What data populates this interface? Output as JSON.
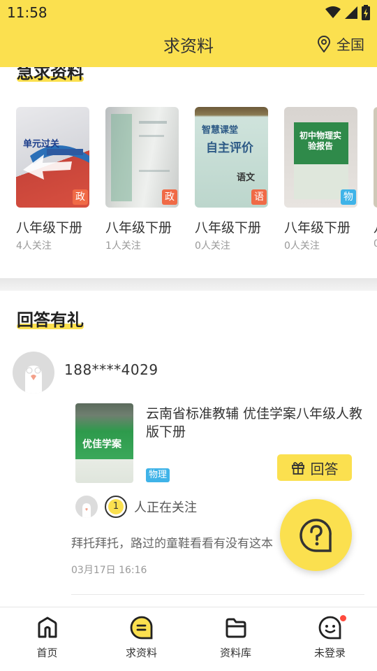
{
  "status_bar": {
    "time": "11:58"
  },
  "header": {
    "title": "求资料",
    "location": "全国"
  },
  "urgent": {
    "title": "急求资料",
    "cards": [
      {
        "title": "八年级下册",
        "followers": "4人关注",
        "badge": "政",
        "badge_color": "#f06a46"
      },
      {
        "title": "八年级下册",
        "followers": "1人关注",
        "badge": "政",
        "badge_color": "#f06a46"
      },
      {
        "title": "八年级下册",
        "followers": "0人关注",
        "badge": "语",
        "badge_color": "#f06a46"
      },
      {
        "title": "八年级下册",
        "followers": "0人关注",
        "badge": "物",
        "badge_color": "#3fb3e8"
      },
      {
        "title": "八",
        "followers": "0",
        "badge": "",
        "badge_color": "#f06a46"
      }
    ],
    "cover_texts": {
      "c1": "单元过关",
      "c3_line1": "智慧课堂",
      "c3_line2": "自主评价",
      "c3_subject": "语文",
      "c4": "初中物理实验报告"
    }
  },
  "answer_section": {
    "title": "回答有礼",
    "post": {
      "username": "188****4029",
      "book_title": "云南省标准教辅  优佳学案八年级人教版下册",
      "book_cover_text": "优佳学案",
      "subject": "物理",
      "answer_label": "回答",
      "follow_count": "1",
      "follow_text": "人正在关注",
      "comment": "拜托拜托，路过的童鞋看看有没有这本",
      "time": "03月17日 16:16"
    }
  },
  "bottom_nav": [
    {
      "label": "首页",
      "icon": "home-icon"
    },
    {
      "label": "求资料",
      "icon": "chat-list-icon"
    },
    {
      "label": "资料库",
      "icon": "folder-icon"
    },
    {
      "label": "未登录",
      "icon": "profile-face-icon"
    }
  ],
  "colors": {
    "accent": "#fbe04f",
    "tag_blue": "#3fb3e8",
    "tag_red": "#f06a46",
    "notify_red": "#ff4a3d"
  }
}
